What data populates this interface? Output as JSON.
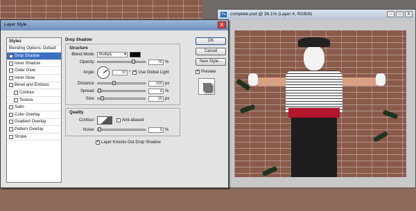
{
  "dialog": {
    "title": "Layer Style",
    "close_glyph": "X",
    "styles_list": [
      {
        "label": "Styles",
        "kind": "header"
      },
      {
        "label": "Blending Options: Default",
        "kind": "plain"
      },
      {
        "label": "Drop Shadow",
        "kind": "check",
        "checked": true,
        "selected": true
      },
      {
        "label": "Inner Shadow",
        "kind": "check",
        "checked": false
      },
      {
        "label": "Outer Glow",
        "kind": "check",
        "checked": false
      },
      {
        "label": "Inner Glow",
        "kind": "check",
        "checked": false
      },
      {
        "label": "Bevel and Emboss",
        "kind": "check",
        "checked": false
      },
      {
        "label": "Contour",
        "kind": "check",
        "checked": false,
        "indent": true
      },
      {
        "label": "Texture",
        "kind": "check",
        "checked": false,
        "indent": true
      },
      {
        "label": "Satin",
        "kind": "check",
        "checked": false
      },
      {
        "label": "Color Overlay",
        "kind": "check",
        "checked": false
      },
      {
        "label": "Gradient Overlay",
        "kind": "check",
        "checked": false
      },
      {
        "label": "Pattern Overlay",
        "kind": "check",
        "checked": false
      },
      {
        "label": "Stroke",
        "kind": "check",
        "checked": false
      }
    ],
    "drop_shadow": {
      "title": "Drop Shadow",
      "structure": {
        "title": "Structure",
        "blend_mode_label": "Blend Mode:",
        "blend_mode_value": "Multiply",
        "blend_color": "#000000",
        "opacity_label": "Opacity:",
        "opacity_value": "75",
        "opacity_fraction": 0.75,
        "angle_label": "Angle:",
        "angle_value": "37",
        "use_global_light_label": "Use Global Light",
        "use_global_light_checked": true,
        "distance_label": "Distance:",
        "distance_value": "100",
        "distance_fraction": 0.33,
        "spread_label": "Spread:",
        "spread_value": "0",
        "spread_fraction": 0,
        "size_label": "Size:",
        "size_value": "15",
        "size_fraction": 0.06,
        "unit_px": "px",
        "unit_pct": "%",
        "degree_sign": "°"
      },
      "quality": {
        "title": "Quality",
        "contour_label": "Contour:",
        "anti_aliased_label": "Anti-aliased",
        "anti_aliased_checked": false,
        "noise_label": "Noise:",
        "noise_value": "0",
        "noise_fraction": 0,
        "knocks_out_label": "Layer Knocks Out Drop Shadow",
        "knocks_out_checked": true
      }
    },
    "buttons": {
      "ok": "OK",
      "cancel": "Cancel",
      "new_style": "New Style...",
      "preview_label": "Preview",
      "preview_checked": true
    }
  },
  "document": {
    "title": "complete.psd @ 36.1% (Layer 4, RGB/8)",
    "icon_label": "Ps",
    "minimize_glyph": "–",
    "maximize_glyph": "□",
    "close_glyph": "X"
  }
}
